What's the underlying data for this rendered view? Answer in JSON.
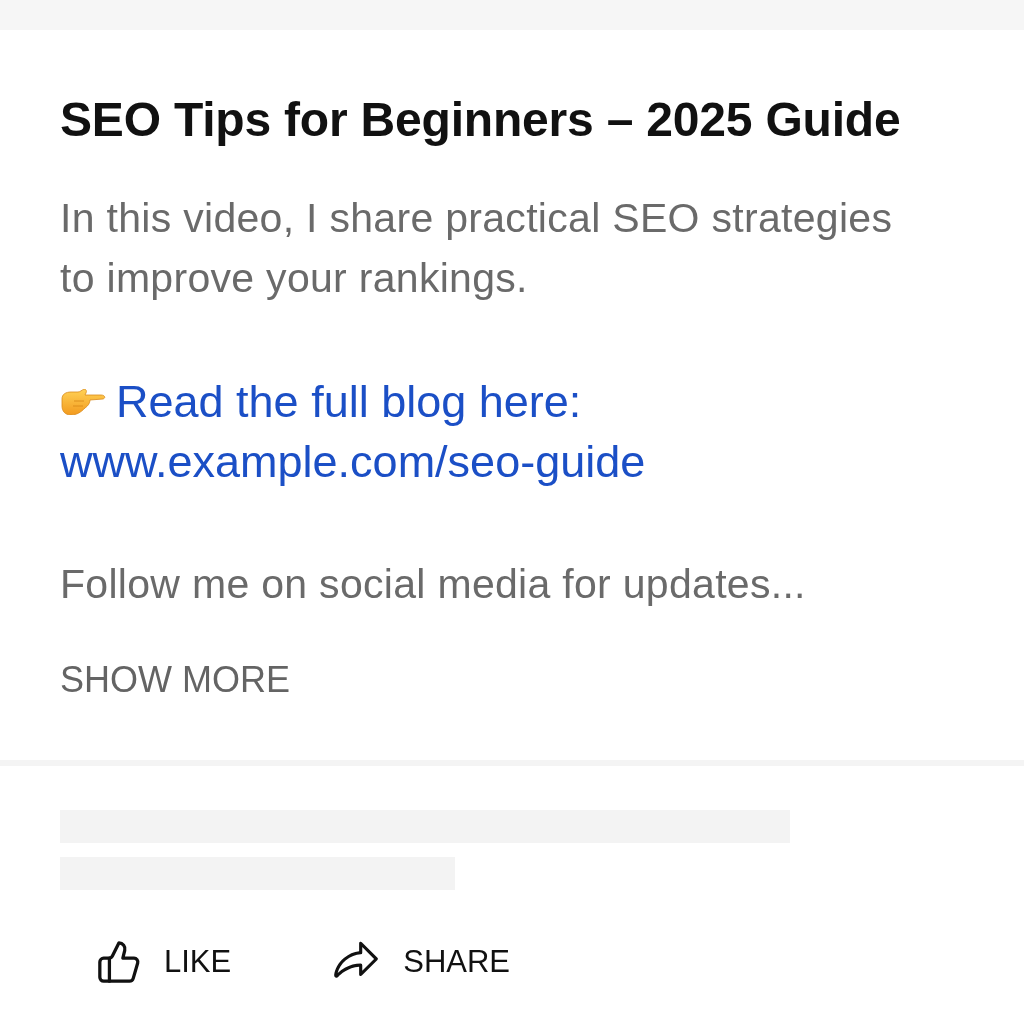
{
  "title": "SEO Tips for Beginners – 2025 Guide",
  "description": {
    "intro": "In this video, I share practical SEO strategies to improve your rankings.",
    "blog_label": "Read the full blog here:",
    "blog_url": "www.example.com/seo-guide",
    "follow": "Follow me on social media for updates..."
  },
  "show_more": "SHOW MORE",
  "actions": [
    {
      "kind": "like",
      "label": "LIKE"
    },
    {
      "kind": "share",
      "label": "SHARE"
    }
  ]
}
